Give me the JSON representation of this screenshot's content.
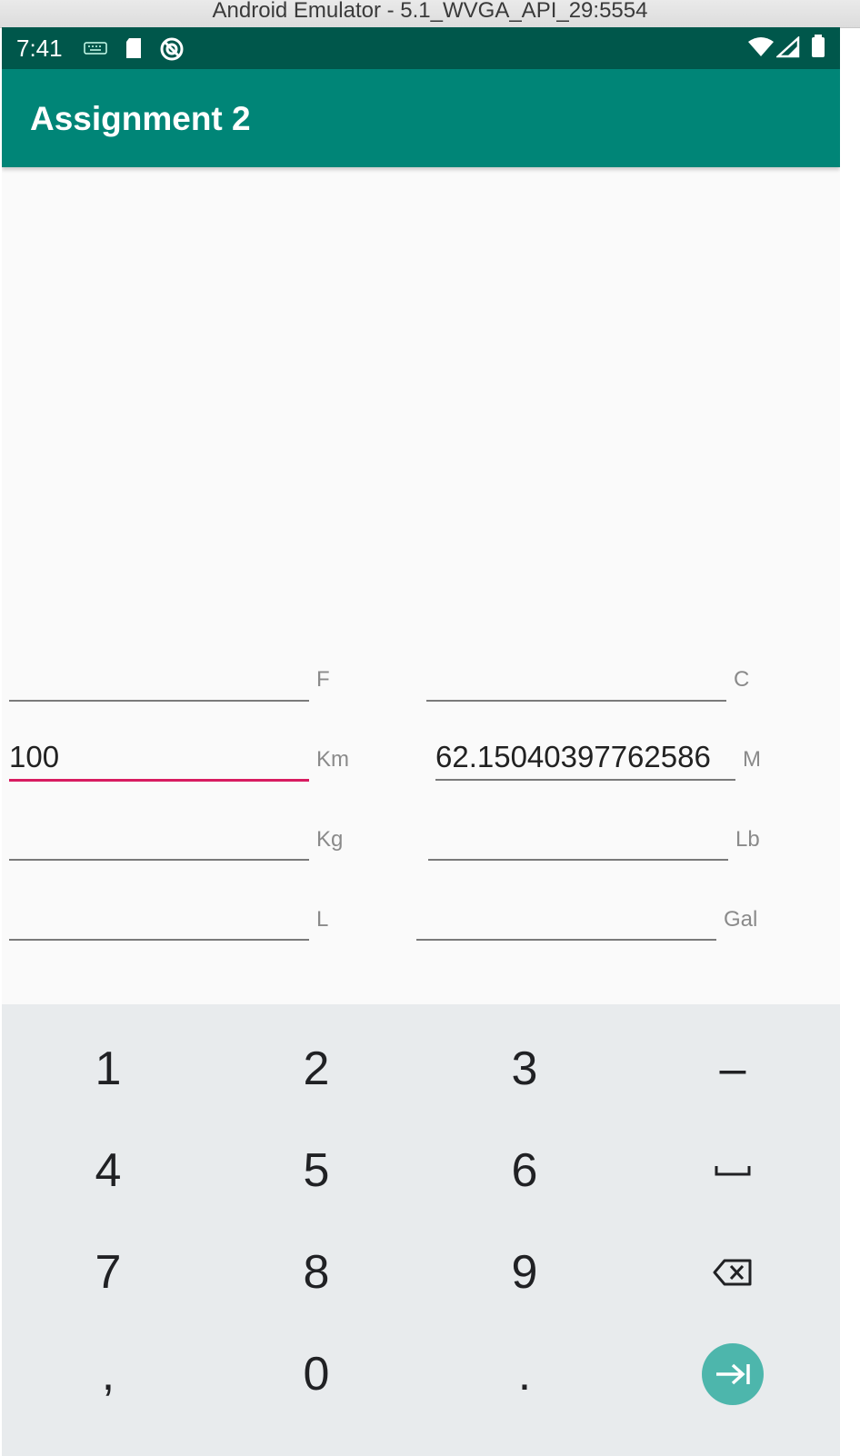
{
  "window": {
    "title": "Android Emulator - 5.1_WVGA_API_29:5554"
  },
  "status_bar": {
    "time": "7:41"
  },
  "app_bar": {
    "title": "Assignment 2"
  },
  "converter": {
    "rows": [
      {
        "left": {
          "value": "",
          "unit": "F"
        },
        "right": {
          "value": "",
          "unit": "C"
        }
      },
      {
        "left": {
          "value": "100",
          "unit": "Km"
        },
        "right": {
          "value": "62.15040397762586",
          "unit": "M"
        }
      },
      {
        "left": {
          "value": "",
          "unit": "Kg"
        },
        "right": {
          "value": "",
          "unit": "Lb"
        }
      },
      {
        "left": {
          "value": "",
          "unit": "L"
        },
        "right": {
          "value": "",
          "unit": "Gal"
        }
      }
    ],
    "focused_field": "km",
    "focus_color": "#d81b60"
  },
  "keyboard": {
    "keys": [
      "1",
      "2",
      "3",
      "–",
      "4",
      "5",
      "6",
      "space",
      "7",
      "8",
      "9",
      "backspace",
      ",",
      "0",
      ".",
      "next"
    ],
    "digit_labels": {
      "k1": "1",
      "k2": "2",
      "k3": "3",
      "minus": "–",
      "k4": "4",
      "k5": "5",
      "k6": "6",
      "k7": "7",
      "k8": "8",
      "k9": "9",
      "comma": ",",
      "k0": "0",
      "period": "."
    },
    "special_icons": [
      "space-bar-icon",
      "backspace-icon",
      "next-arrow-icon"
    ],
    "enter_color": "#4db6ac"
  },
  "colors": {
    "status_bar": "#00574b",
    "app_bar": "#008577",
    "background": "#fafafa",
    "keyboard": "#e8ebed"
  }
}
